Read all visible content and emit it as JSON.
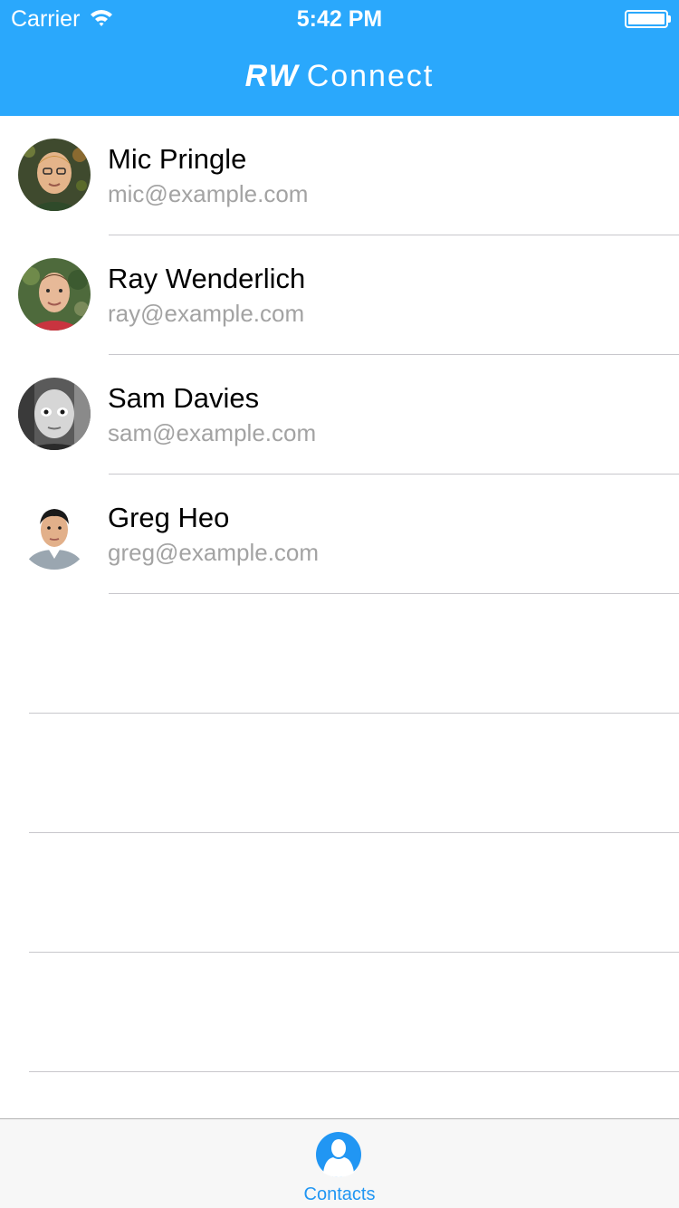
{
  "status_bar": {
    "carrier": "Carrier",
    "time": "5:42 PM",
    "wifi_icon": "wifi-icon",
    "battery_icon": "battery-icon",
    "battery_level": 1.0
  },
  "nav": {
    "title_bold": "RW",
    "title_light": "Connect",
    "background_color": "#2aa8fc"
  },
  "contacts": [
    {
      "name": "Mic Pringle",
      "email": "mic@example.com"
    },
    {
      "name": "Ray Wenderlich",
      "email": "ray@example.com"
    },
    {
      "name": "Sam Davies",
      "email": "sam@example.com"
    },
    {
      "name": "Greg Heo",
      "email": "greg@example.com"
    }
  ],
  "tab_bar": {
    "tabs": [
      {
        "label": "Contacts",
        "icon": "contacts-icon",
        "selected": true
      }
    ],
    "tint_color": "#2196f3"
  },
  "colors": {
    "secondary_text": "#a3a3a3",
    "separator": "#c8c7cc"
  }
}
